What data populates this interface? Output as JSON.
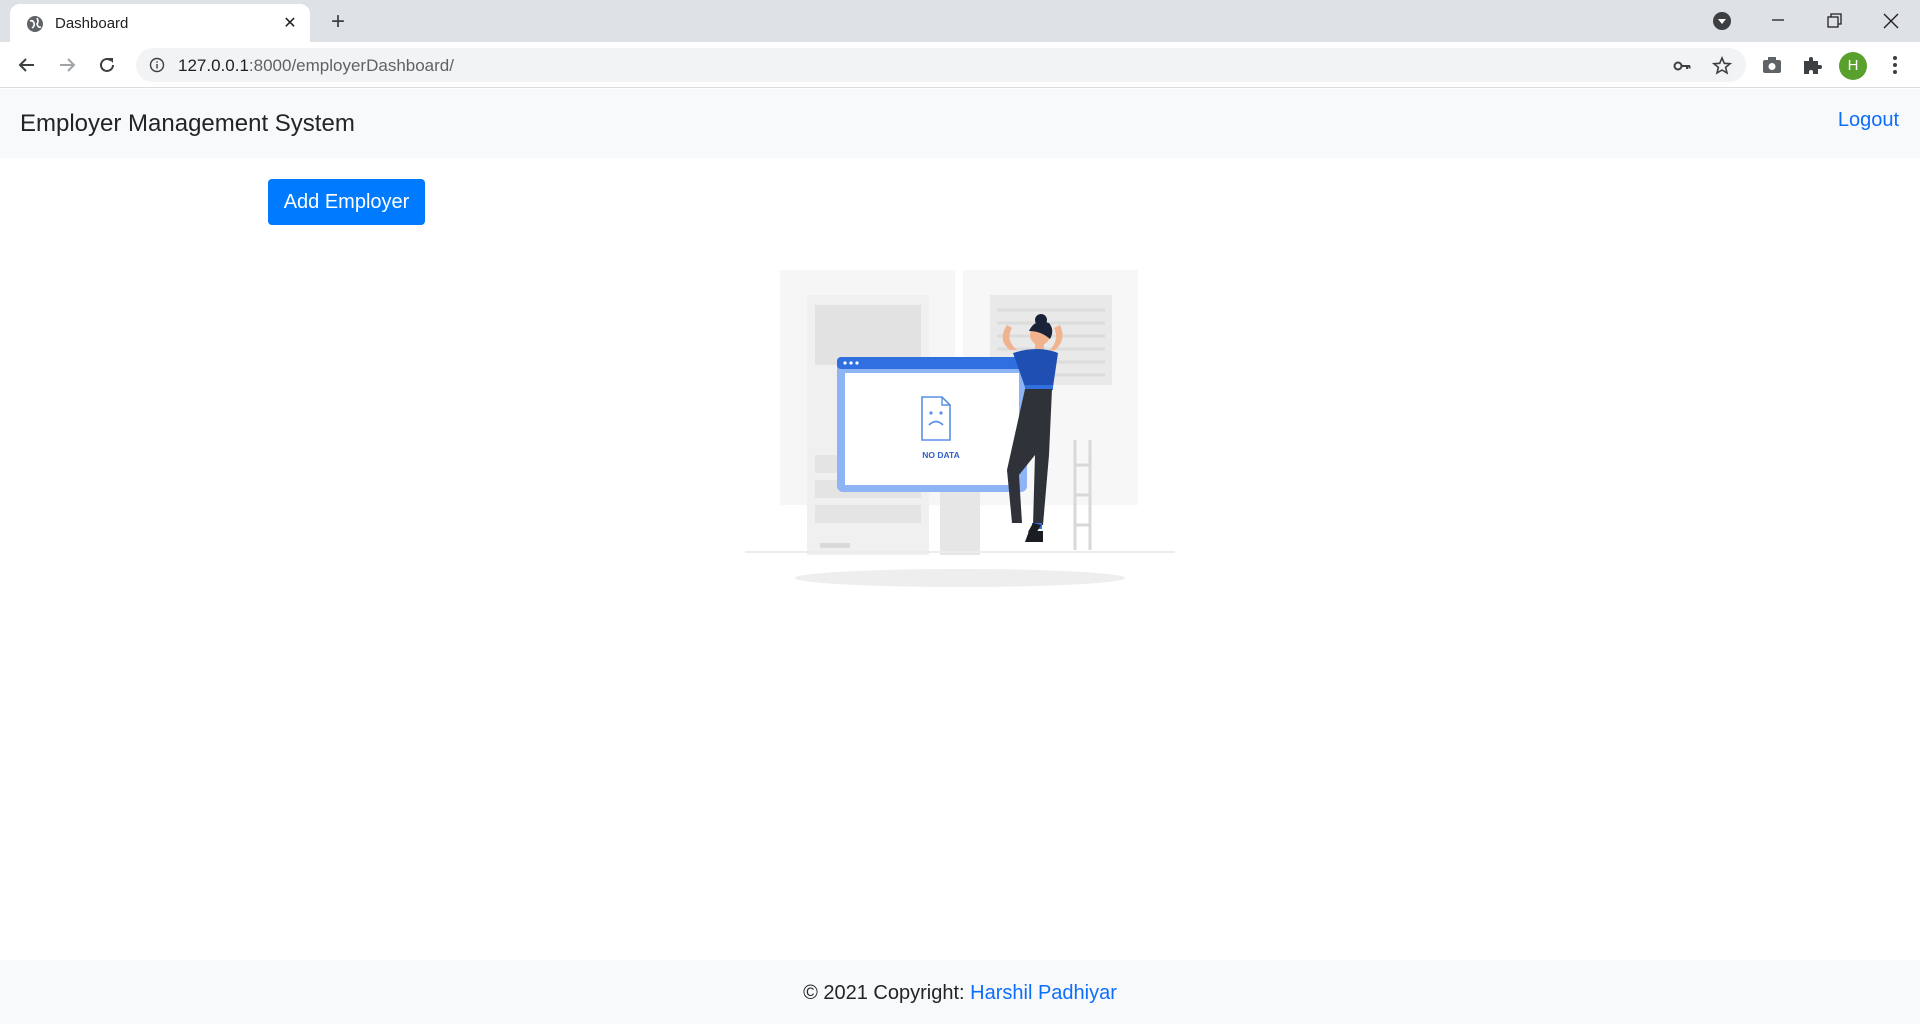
{
  "browser": {
    "tab_title": "Dashboard",
    "tab_close": "✕",
    "new_tab": "+",
    "url_host": "127.0.0.1",
    "url_path": ":8000/employerDashboard/",
    "profile_initial": "H"
  },
  "navbar": {
    "brand": "Employer Management System",
    "logout_label": "Logout"
  },
  "main": {
    "add_button_label": "Add Employer",
    "empty_state_text": "NO DATA"
  },
  "footer": {
    "copyright": "© 2021 Copyright: ",
    "author": "Harshil Padhiyar"
  },
  "colors": {
    "primary": "#007bff",
    "link": "#0d6efd",
    "navbar_bg": "#f8f9fa",
    "chrome_bg": "#dee1e6"
  }
}
